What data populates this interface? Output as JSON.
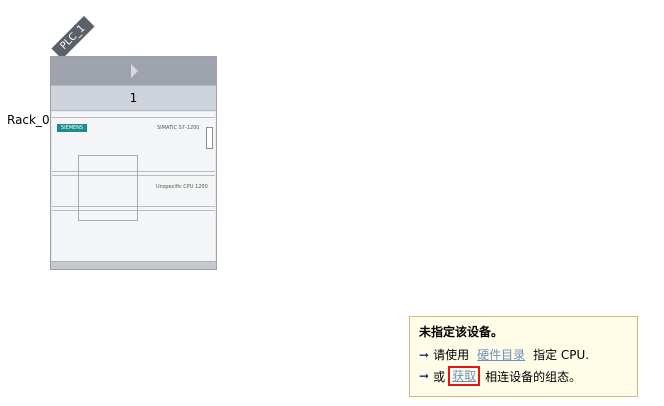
{
  "device": {
    "name_tag": "PLC_1",
    "rack_label": "Rack_0",
    "slot_number": "1",
    "module": {
      "brand": "SIEMENS",
      "model": "SIMATIC S7-1200",
      "cpu_type": "Unspecific CPU 1200"
    }
  },
  "notice": {
    "title": "未指定该设备。",
    "line1": {
      "prefix": "请使用",
      "link": "硬件目录",
      "suffix": "指定 CPU."
    },
    "line2": {
      "prefix": "或",
      "link": "获取",
      "suffix": "相连设备的组态。"
    }
  },
  "colors": {
    "rack_header": "#9ea3ad",
    "brand": "#1f8a8a",
    "notice_bg": "#fffde8",
    "highlight_box": "#e01818",
    "link": "#6d8fc0"
  },
  "icons": [
    "right-arrow-icon",
    "connector-icon"
  ]
}
